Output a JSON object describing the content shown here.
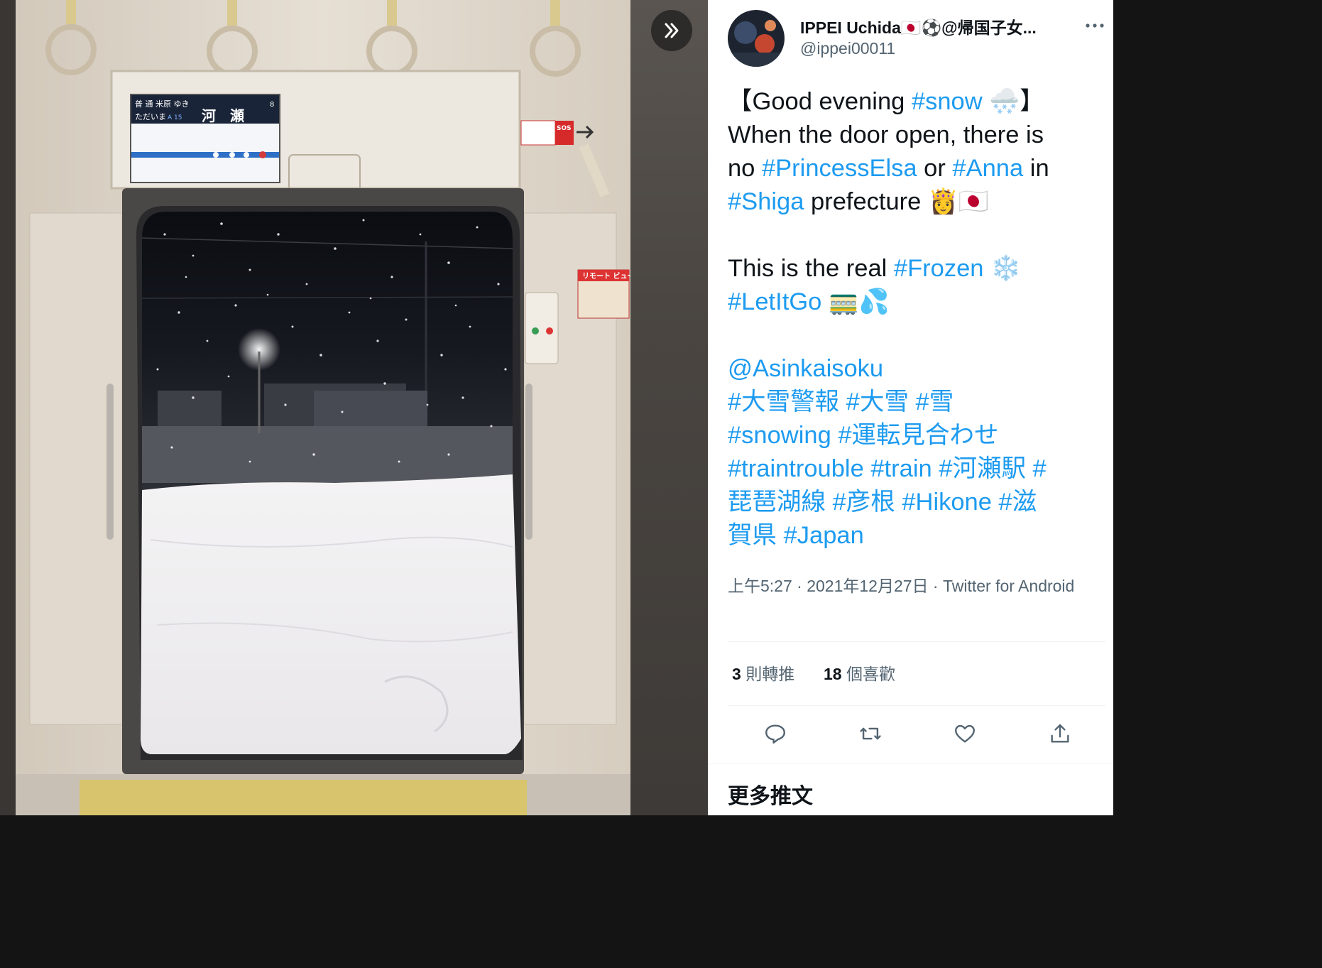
{
  "media": {
    "alt": "",
    "screen_sign": {
      "line1": "普 通  米原 ゆき",
      "line2_left": "ただいま",
      "station_code": "A 15",
      "station": "河　瀬",
      "car_number": "8"
    },
    "sos_label": "SOS",
    "poster_text": "リモート ビュー"
  },
  "author": {
    "name": "IPPEI Uchida🇯🇵⚽@帰国子女...",
    "handle": "@ippei00011"
  },
  "tweet": {
    "lines": [
      [
        {
          "t": "【Good evening "
        },
        {
          "t": "#snow",
          "h": true
        },
        {
          "t": " 🌨️】"
        }
      ],
      [
        {
          "t": "When the door open, there is"
        }
      ],
      [
        {
          "t": "no "
        },
        {
          "t": "#PrincessElsa",
          "h": true
        },
        {
          "t": " or "
        },
        {
          "t": "#Anna",
          "h": true
        },
        {
          "t": " in"
        }
      ],
      [
        {
          "t": "#Shiga",
          "h": true
        },
        {
          "t": " prefecture 👸🇯🇵"
        }
      ],
      [],
      [
        {
          "t": "This is the real "
        },
        {
          "t": "#Frozen",
          "h": true
        },
        {
          "t": " ❄️"
        }
      ],
      [
        {
          "t": "#LetItGo",
          "h": true
        },
        {
          "t": " 🚃💦"
        }
      ],
      [],
      [
        {
          "t": "@Asinkaisoku",
          "h": true
        }
      ],
      [
        {
          "t": "#大雪警報 #大雪 #雪",
          "h": true
        }
      ],
      [
        {
          "t": "#snowing #運転見合わせ",
          "h": true
        }
      ],
      [
        {
          "t": "#traintrouble #train #河瀬駅 #",
          "h": true
        }
      ],
      [
        {
          "t": "琵琶湖線 #彦根 #Hikone #滋",
          "h": true
        }
      ],
      [
        {
          "t": "賀県 #Japan",
          "h": true
        }
      ]
    ]
  },
  "meta": {
    "timestamp": "上午5:27 · 2021年12月27日 · Twitter for Android"
  },
  "stats": {
    "retweets_count": "3",
    "retweets_label": "則轉推",
    "likes_count": "18",
    "likes_label": "個喜歡"
  },
  "section": {
    "more_tweets": "更多推文"
  },
  "colors": {
    "link": "#1d9bf0",
    "text": "#0f1419",
    "secondary": "#536471"
  },
  "icons": [
    "double-chevron-right-icon",
    "more-icon",
    "reply-icon",
    "retweet-icon",
    "like-icon",
    "share-icon"
  ]
}
